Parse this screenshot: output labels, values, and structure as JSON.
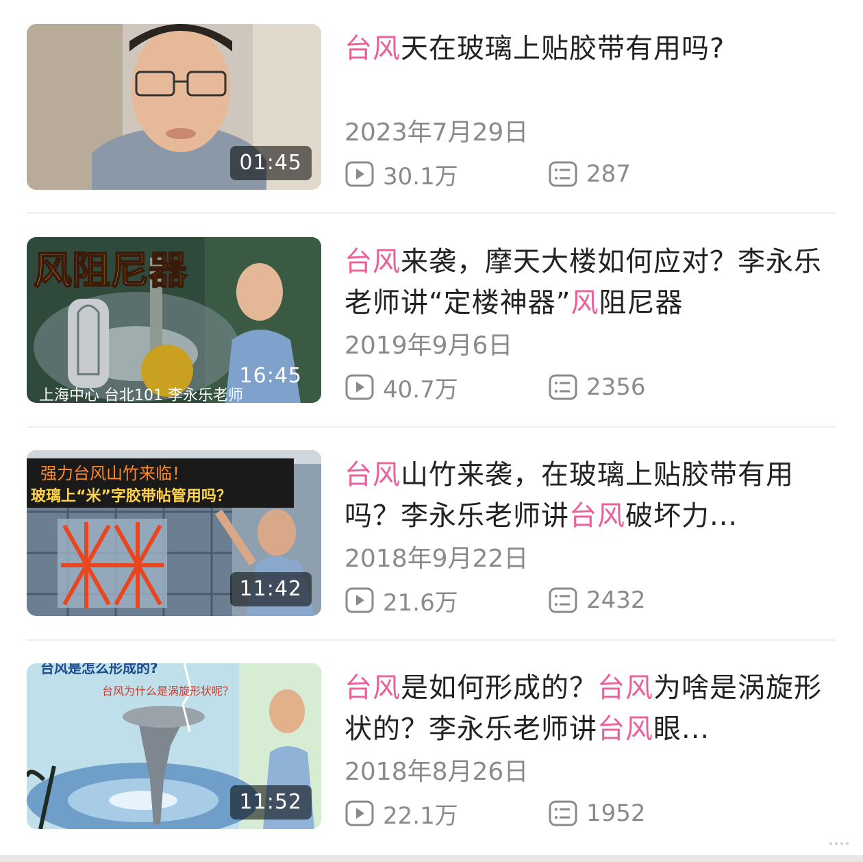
{
  "videos": [
    {
      "title_parts": [
        {
          "text": "台风",
          "hl": true
        },
        {
          "text": "天在玻璃上贴胶带有用吗?",
          "hl": false
        }
      ],
      "date": "2023年7月29日",
      "views": "30.1万",
      "comments": "287",
      "duration": "01:45"
    },
    {
      "title_parts": [
        {
          "text": "台风",
          "hl": true
        },
        {
          "text": "来袭，摩天大楼如何应对？李永乐老师讲“定楼神器”",
          "hl": false
        },
        {
          "text": "风",
          "hl": true
        },
        {
          "text": "阻尼器",
          "hl": false
        }
      ],
      "date": "2019年9月6日",
      "views": "40.7万",
      "comments": "2356",
      "duration": "16:45",
      "thumb_text": {
        "headline": "风阻尼器",
        "caption": "上海中心 台北101 李永乐老师"
      }
    },
    {
      "title_parts": [
        {
          "text": "台风",
          "hl": true
        },
        {
          "text": "山竹来袭，在玻璃上贴胶带有用吗？李永乐老师讲",
          "hl": false
        },
        {
          "text": "台风",
          "hl": true
        },
        {
          "text": "破坏力...",
          "hl": false
        }
      ],
      "date": "2018年9月22日",
      "views": "21.6万",
      "comments": "2432",
      "duration": "11:42",
      "thumb_text": {
        "line1": "强力台风山竹来临！",
        "line2": "玻璃上“米”字胶带帖管用吗？"
      }
    },
    {
      "title_parts": [
        {
          "text": "台风",
          "hl": true
        },
        {
          "text": "是如何形成的？",
          "hl": false
        },
        {
          "text": "台风",
          "hl": true
        },
        {
          "text": "为啥是涡旋形状的？李永乐老师讲",
          "hl": false
        },
        {
          "text": "台风",
          "hl": true
        },
        {
          "text": "眼...",
          "hl": false
        }
      ],
      "date": "2018年8月26日",
      "views": "22.1万",
      "comments": "1952",
      "duration": "11:52",
      "thumb_text": {
        "line1": "台风是怎么形成的?",
        "line2": "台风为什么是涡旋形状呢？"
      }
    }
  ],
  "colors": {
    "highlight": "#ec5f9a",
    "meta": "#8a8a8a",
    "title": "#222222"
  },
  "icons": {
    "views": "play-icon",
    "comments": "comment-icon"
  }
}
